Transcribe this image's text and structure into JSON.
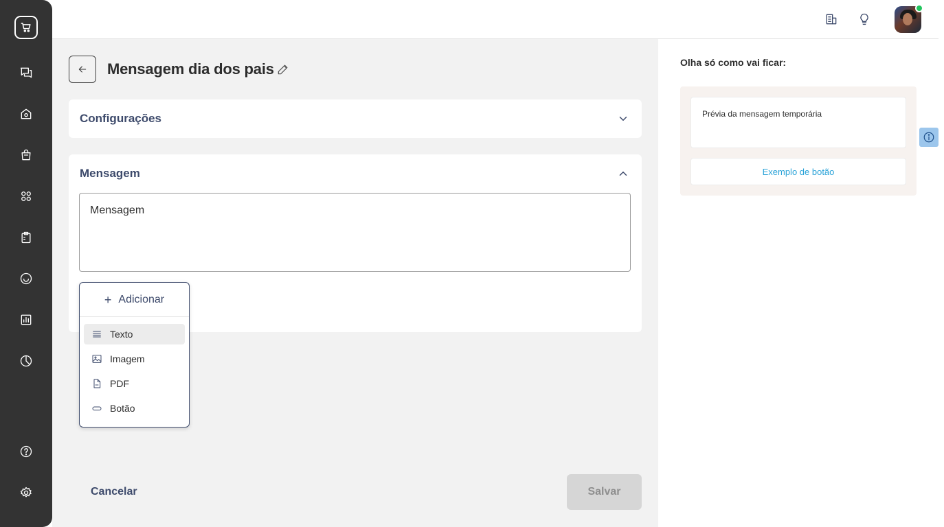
{
  "sidebar": {
    "logo_icon": "cart-chat-logo-icon",
    "items": [
      {
        "icon": "chat-icon"
      },
      {
        "icon": "store-icon"
      },
      {
        "icon": "shopping-bag-icon"
      },
      {
        "icon": "apps-grid-icon"
      },
      {
        "icon": "clipboard-icon"
      },
      {
        "icon": "smile-icon"
      },
      {
        "icon": "bar-chart-icon"
      },
      {
        "icon": "pie-chart-icon"
      }
    ],
    "bottom_items": [
      {
        "icon": "help-icon"
      },
      {
        "icon": "settings-icon"
      }
    ]
  },
  "header": {
    "icons": [
      "building-icon",
      "lightbulb-icon"
    ],
    "avatar_status_color": "#22c55e"
  },
  "page": {
    "title": "Mensagem dia dos pais"
  },
  "sections": {
    "config": {
      "title": "Configurações"
    },
    "message": {
      "title": "Mensagem",
      "textarea_placeholder": "Mensagem"
    }
  },
  "add_menu": {
    "button_label": "Adicionar",
    "items": [
      {
        "label": "Texto",
        "icon": "text-lines-icon",
        "active": true
      },
      {
        "label": "Imagem",
        "icon": "image-icon",
        "active": false
      },
      {
        "label": "PDF",
        "icon": "pdf-file-icon",
        "active": false
      },
      {
        "label": "Botão",
        "icon": "button-pill-icon",
        "active": false
      }
    ]
  },
  "footer": {
    "cancel_label": "Cancelar",
    "save_label": "Salvar"
  },
  "preview": {
    "title": "Olha só como vai ficar:",
    "message_text": "Prévia da mensagem temporária",
    "button_text": "Exemplo de botão"
  },
  "colors": {
    "sidebar_bg": "#333333",
    "accent_navy": "#3d4a6b",
    "link_blue": "#2ba3d8",
    "preview_bg": "#f7f2ef",
    "disabled_btn": "#d6d6d6"
  }
}
